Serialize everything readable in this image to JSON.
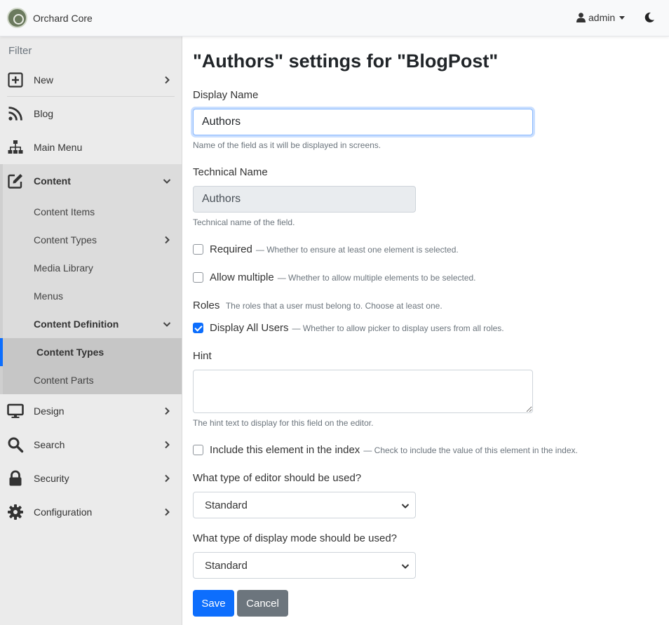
{
  "header": {
    "brand": "Orchard Core",
    "user": "admin"
  },
  "sidebar": {
    "filter_placeholder": "Filter",
    "items": [
      {
        "label": "New",
        "icon": "plus-square-icon"
      },
      {
        "label": "Blog",
        "icon": "rss-icon"
      },
      {
        "label": "Main Menu",
        "icon": "sitemap-icon"
      },
      {
        "label": "Content",
        "icon": "edit-icon"
      },
      {
        "label": "Design",
        "icon": "desktop-icon"
      },
      {
        "label": "Search",
        "icon": "search-icon"
      },
      {
        "label": "Security",
        "icon": "lock-icon"
      },
      {
        "label": "Configuration",
        "icon": "gear-icon"
      }
    ],
    "content_sub": [
      "Content Items",
      "Content Types",
      "Media Library",
      "Menus",
      "Content Definition",
      "Content Types",
      "Content Parts"
    ]
  },
  "page": {
    "title": "\"Authors\" settings for \"BlogPost\"",
    "display_name_label": "Display Name",
    "display_name_value": "Authors",
    "display_name_hint": "Name of the field as it will be displayed in screens.",
    "technical_name_label": "Technical Name",
    "technical_name_value": "Authors",
    "technical_name_hint": "Technical name of the field.",
    "required_label": "Required",
    "required_desc": "— Whether to ensure at least one element is selected.",
    "multiple_label": "Allow multiple",
    "multiple_desc": "— Whether to allow multiple elements to be selected.",
    "roles_label": "Roles",
    "roles_desc": "The roles that a user must belong to. Choose at least one.",
    "display_all_label": "Display All Users",
    "display_all_desc": "— Whether to allow picker to display users from all roles.",
    "hint_label": "Hint",
    "hint_hint": "The hint text to display for this field on the editor.",
    "index_label": "Include this element in the index",
    "index_desc": "— Check to include the value of this element in the index.",
    "editor_label": "What type of editor should be used?",
    "editor_value": "Standard",
    "display_mode_label": "What type of display mode should be used?",
    "display_mode_value": "Standard",
    "save": "Save",
    "cancel": "Cancel"
  },
  "state": {
    "required": false,
    "allow_multiple": false,
    "display_all_users": true,
    "include_in_index": false
  },
  "colors": {
    "primary": "#0d6efd",
    "secondary": "#6c757d",
    "sidebar_bg": "#ebebeb",
    "active_border": "#0d6efd"
  }
}
